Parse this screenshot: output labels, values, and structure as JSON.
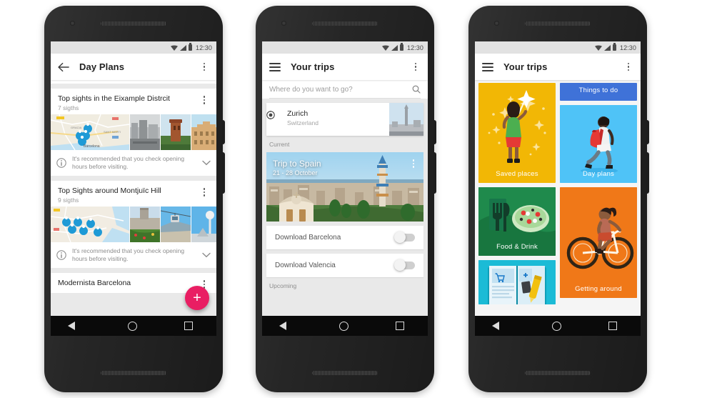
{
  "status_bar": {
    "time": "12:30",
    "icons": [
      "wifi-icon",
      "signal-icon",
      "battery-icon"
    ]
  },
  "phone1": {
    "appbar": {
      "back_icon": "back-arrow-icon",
      "title": "Day Plans",
      "overflow_icon": "overflow-menu-icon"
    },
    "cards": [
      {
        "title": "Top sights in the Eixample Distrcit",
        "subtitle": "7 sigths",
        "note": "It's recommended that you check opening hours before visiting.",
        "note_icon": "info-icon",
        "expand_icon": "chevron-down-icon",
        "overflow_icon": "overflow-menu-icon"
      },
      {
        "title": "Top Sights around Montjuïc Hill",
        "subtitle": "9 sigths",
        "note": "It's recommended that you check opening hours before visiting.",
        "note_icon": "info-icon",
        "expand_icon": "chevron-down-icon",
        "overflow_icon": "overflow-menu-icon"
      }
    ],
    "last_card_title": "Modernista Barcelona",
    "fab": {
      "label": "+",
      "color": "#e91e63",
      "name": "add-plan-fab"
    }
  },
  "phone2": {
    "appbar": {
      "menu_icon": "hamburger-menu-icon",
      "title": "Your trips",
      "overflow_icon": "overflow-menu-icon"
    },
    "search": {
      "placeholder": "Where do you want to go?",
      "icon": "search-icon"
    },
    "suggestion": {
      "name": "Zurich",
      "country": "Switzerland",
      "icon": "target-location-icon"
    },
    "section_current": "Current",
    "trip": {
      "title": "Trip to Spain",
      "dates": "21 - 28 October",
      "overflow_icon": "overflow-menu-icon"
    },
    "downloads": [
      {
        "label": "Download Barcelona",
        "state": "off"
      },
      {
        "label": "Download Valencia",
        "state": "off"
      }
    ],
    "section_upcoming": "Upcoming"
  },
  "phone3": {
    "appbar": {
      "menu_icon": "hamburger-menu-icon",
      "title": "Your trips",
      "overflow_icon": "overflow-menu-icon"
    },
    "tiles": [
      {
        "label": "Saved places",
        "color": "#F2B705",
        "illustration": "person-with-stars"
      },
      {
        "label": "Things to do",
        "color": "#3F72D8",
        "illustration": "things-to-do"
      },
      {
        "label": "Day plans",
        "color": "#4FC3F7",
        "illustration": "walking-person-backpack"
      },
      {
        "label": "Food & Drink",
        "color": "#1F8A4C",
        "illustration": "salad-cutlery"
      },
      {
        "label": "Getting around",
        "color": "#F07818",
        "illustration": "person-on-bicycle"
      },
      {
        "label": "",
        "color": "#1BBBD6",
        "illustration": "open-guidebook"
      }
    ]
  },
  "navbar": {
    "back_icon": "nav-back-icon",
    "home_icon": "nav-home-icon",
    "recents_icon": "nav-recents-icon"
  }
}
